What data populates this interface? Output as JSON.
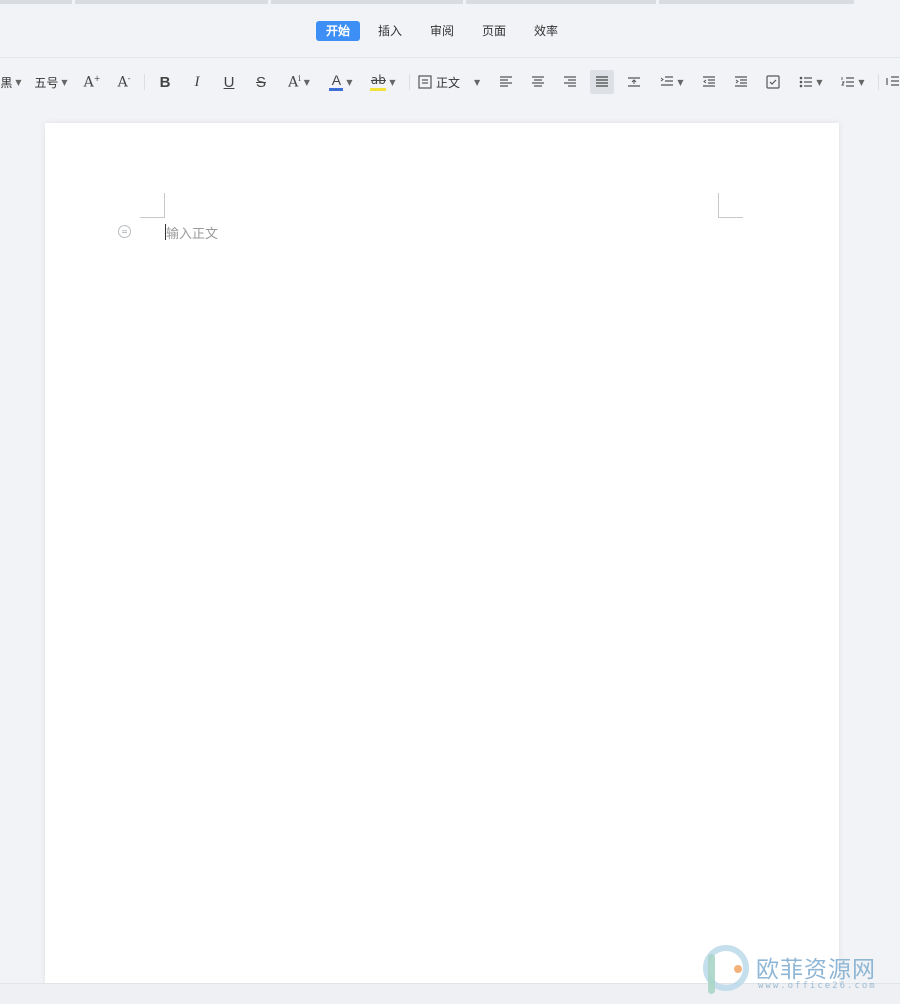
{
  "menu": {
    "tabs": [
      {
        "label": "开始",
        "active": true
      },
      {
        "label": "插入",
        "active": false
      },
      {
        "label": "审阅",
        "active": false
      },
      {
        "label": "页面",
        "active": false
      },
      {
        "label": "效率",
        "active": false
      }
    ]
  },
  "toolbar": {
    "font_family_partial": "黒",
    "font_size": "五号",
    "increase_font": "A",
    "decrease_font": "A",
    "bold": "B",
    "italic": "I",
    "underline": "U",
    "strikethrough": "S",
    "superscript": "A",
    "font_color": "A",
    "highlight": "ab",
    "style_label": "正文",
    "font_color_hex": "#3d6fd6",
    "highlight_hex": "#f3e23a",
    "icons": [
      "font-family-caret",
      "increase-font-icon",
      "decrease-font-icon",
      "bold-icon",
      "italic-icon",
      "underline-icon",
      "strikethrough-icon",
      "superscript-icon",
      "font-color-icon",
      "highlight-icon",
      "paragraph-style-icon",
      "align-left-icon",
      "align-center-icon",
      "align-right-icon",
      "justify-icon",
      "line-spacing-icon",
      "indent-list-icon",
      "decrease-indent-icon",
      "increase-indent-icon",
      "checkbox-list-icon",
      "bullet-list-icon",
      "numbered-list-icon",
      "overflow-icon"
    ]
  },
  "document": {
    "placeholder": "输入正文"
  },
  "watermark": {
    "title": "欧菲资源网",
    "subtitle": "www.office26.com"
  },
  "colors": {
    "accent": "#3d8ff5",
    "background": "#f1f3f6",
    "page": "#ffffff"
  }
}
